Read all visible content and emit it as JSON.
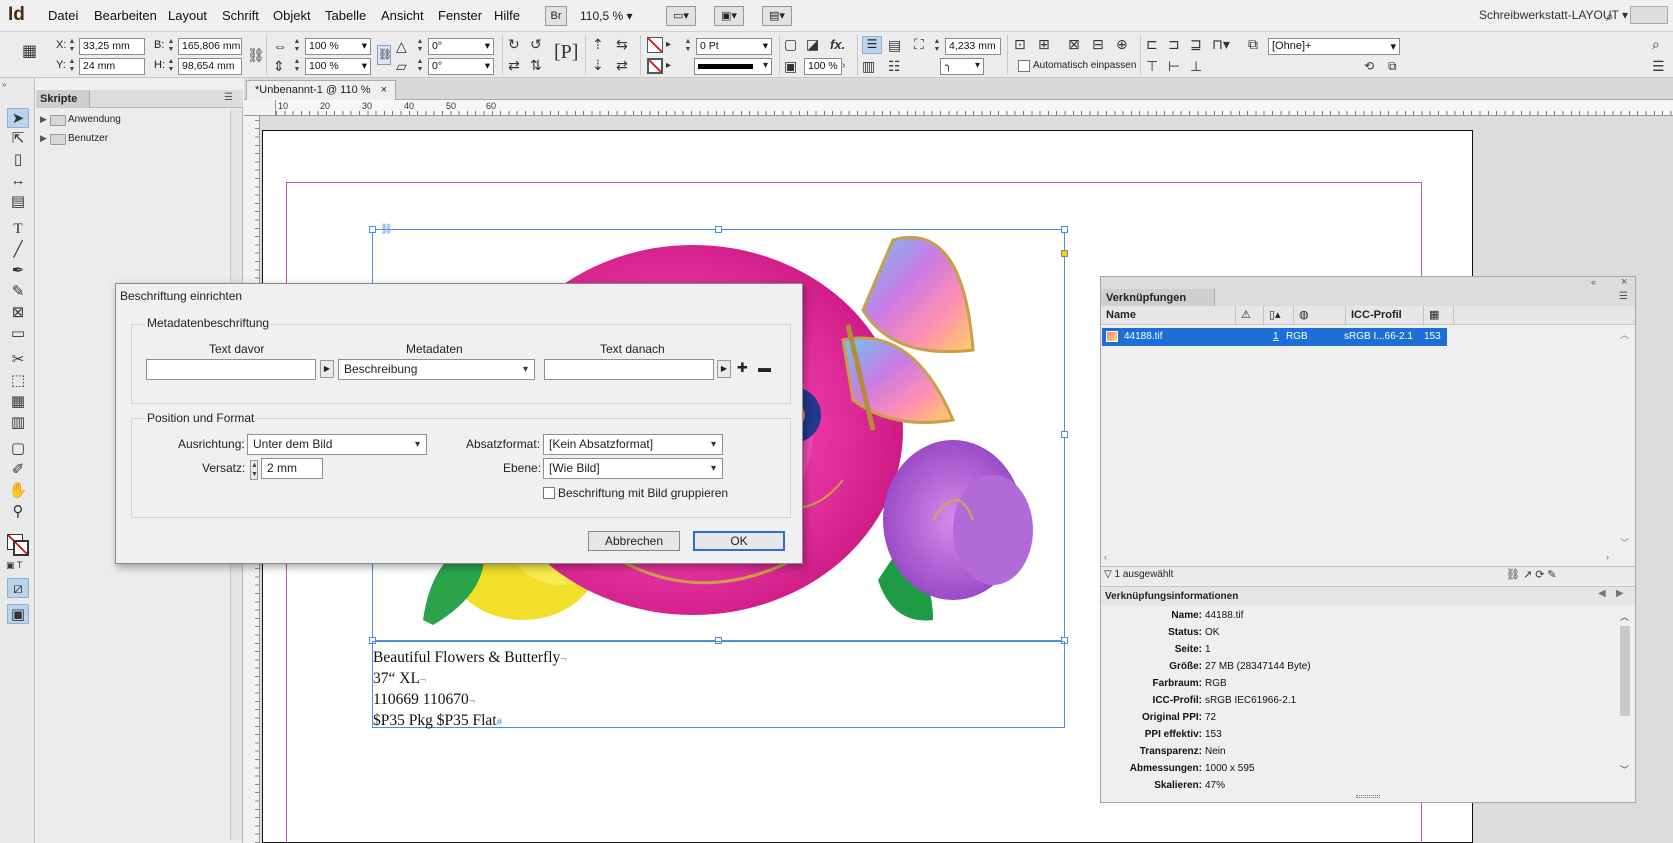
{
  "app": {
    "logo": "Id",
    "menus": [
      "Datei",
      "Bearbeiten",
      "Layout",
      "Schrift",
      "Objekt",
      "Tabelle",
      "Ansicht",
      "Fenster",
      "Hilfe"
    ],
    "bridge": "Br",
    "zoom": "110,5 %",
    "workspace": "Schreibwerkstatt-LAYOUT"
  },
  "control": {
    "x_label": "X:",
    "x": "33,25 mm",
    "y_label": "Y:",
    "y": "24 mm",
    "w_label": "B:",
    "w": "165,806 mm",
    "h_label": "H:",
    "h": "98,654 mm",
    "scale_x": "100 %",
    "scale_y": "100 %",
    "rot": "0°",
    "shear": "0°",
    "stroke": "0 Pt",
    "opacity": "100 %",
    "offset": "4,233 mm",
    "autofit": "Automatisch einpassen",
    "style": "[Ohne]+"
  },
  "scripts_panel": {
    "title": "Skripte",
    "items": [
      "Anwendung",
      "Benutzer"
    ]
  },
  "doc": {
    "tab": "*Unbenannt-1 @ 110 %",
    "ruler": [
      "10",
      "20",
      "30",
      "40",
      "50",
      "60"
    ],
    "caption_lines": [
      "Beautiful Flowers & Butterfly",
      "37“ XL",
      "110669 110670",
      "$P35 Pkg $P35 Flat"
    ]
  },
  "dialog": {
    "title": "Beschriftung einrichten",
    "meta_group": "Metadatenbeschriftung",
    "text_before": "Text davor",
    "metadata": "Metadaten",
    "text_after": "Text danach",
    "metadata_value": "Beschreibung",
    "before_value": "",
    "after_value": "",
    "pos_group": "Position und Format",
    "align_label": "Ausrichtung:",
    "align_value": "Unter dem Bild",
    "offset_label": "Versatz:",
    "offset_value": "2 mm",
    "para_label": "Absatzformat:",
    "para_value": "[Kein Absatzformat]",
    "layer_label": "Ebene:",
    "layer_value": "[Wie Bild]",
    "group_label": "Beschriftung mit Bild gruppieren",
    "cancel": "Abbrechen",
    "ok": "OK"
  },
  "links": {
    "title": "Verknüpfungen",
    "cols": [
      "Name",
      "ICC-Profil"
    ],
    "row": {
      "name": "44188.tif",
      "page": "1",
      "space": "RGB",
      "icc": "sRGB I...66-2.1",
      "ppi": "153"
    },
    "selected": "1 ausgewählt",
    "info_title": "Verknüpfungsinformationen",
    "info": [
      {
        "k": "Name:",
        "v": "44188.tif"
      },
      {
        "k": "Status:",
        "v": "OK"
      },
      {
        "k": "Seite:",
        "v": "1"
      },
      {
        "k": "Größe:",
        "v": "27 MB (28347144 Byte)"
      },
      {
        "k": "Farbraum:",
        "v": "RGB"
      },
      {
        "k": "ICC-Profil:",
        "v": "sRGB IEC61966-2.1"
      },
      {
        "k": "Original PPI:",
        "v": "72"
      },
      {
        "k": "PPI effektiv:",
        "v": "153"
      },
      {
        "k": "Transparenz:",
        "v": "Nein"
      },
      {
        "k": "Abmessungen:",
        "v": "1000 x 595"
      },
      {
        "k": "Skalieren:",
        "v": "47%"
      }
    ]
  },
  "colors": {
    "accent": "#2e6fca",
    "selection": "#4c8fd8",
    "margin": "#b35bb3",
    "row_selected": "#1d6fd6"
  }
}
